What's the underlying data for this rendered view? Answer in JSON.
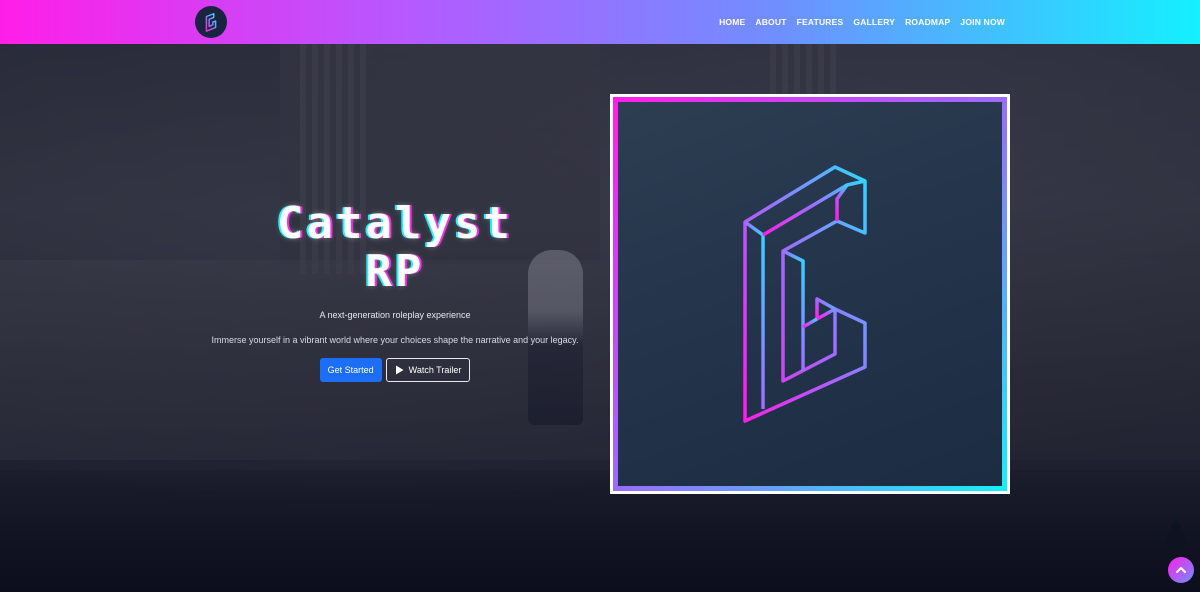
{
  "nav": {
    "logo_icon": "catalyst-logo-icon",
    "links": [
      {
        "label": "HOME"
      },
      {
        "label": "ABOUT"
      },
      {
        "label": "FEATURES"
      },
      {
        "label": "GALLERY"
      },
      {
        "label": "ROADMAP"
      },
      {
        "label": "JOIN NOW"
      }
    ]
  },
  "hero": {
    "title_line1": "Catalyst",
    "title_line2": "RP",
    "tagline": "A next-generation roleplay experience",
    "description": "Immerse yourself in a vibrant world where your choices shape the narrative and your legacy.",
    "primary_button": "Get Started",
    "secondary_button": "Watch Trailer",
    "secondary_icon": "play-icon"
  },
  "colors": {
    "gradient_start": "#ff1ee8",
    "gradient_end": "#14f0ff",
    "primary_button": "#1b6ef5"
  },
  "floating": {
    "scroll_top_icon": "chevron-up-icon"
  }
}
